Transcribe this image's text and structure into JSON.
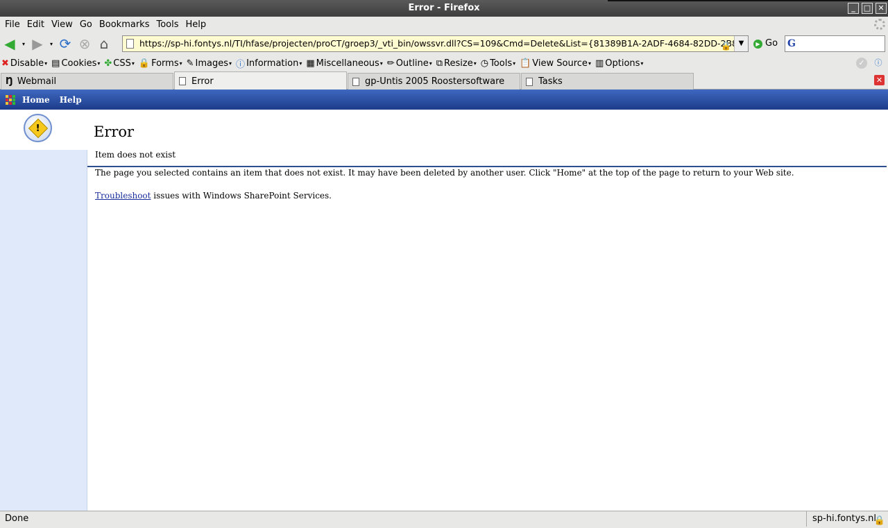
{
  "window": {
    "title": "Error - Firefox"
  },
  "menu": [
    "File",
    "Edit",
    "View",
    "Go",
    "Bookmarks",
    "Tools",
    "Help"
  ],
  "nav": {
    "url": "https://sp-hi.fontys.nl/TI/hfase/projecten/proCT/groep3/_vti_bin/owssvr.dll?CS=109&Cmd=Delete&List={81389B1A-2ADF-4684-82DD-2B8",
    "go_label": "Go"
  },
  "devtoolbar": [
    "Disable",
    "Cookies",
    "CSS",
    "Forms",
    "Images",
    "Information",
    "Miscellaneous",
    "Outline",
    "Resize",
    "Tools",
    "View Source",
    "Options"
  ],
  "tabs": [
    {
      "label": "Webmail"
    },
    {
      "label": "Error"
    },
    {
      "label": "gp-Untis 2005 Roostersoftware"
    },
    {
      "label": "Tasks"
    }
  ],
  "sharepoint": {
    "nav": {
      "home": "Home",
      "help": "Help"
    },
    "title": "Error",
    "message_title": "Item does not exist",
    "message": "The page you selected contains an item that does not exist.  It may have been deleted by another user.  Click \"Home\" at the top of the page to return to your Web site.",
    "troubleshoot_link": "Troubleshoot",
    "troubleshoot_rest": " issues with Windows SharePoint Services."
  },
  "status": {
    "text": "Done",
    "host": "sp-hi.fontys.nl"
  },
  "colors": {
    "sp_bar": "#1c3c8a",
    "left_nav": "#dfe9fa",
    "url_bg": "#fffbd0"
  }
}
